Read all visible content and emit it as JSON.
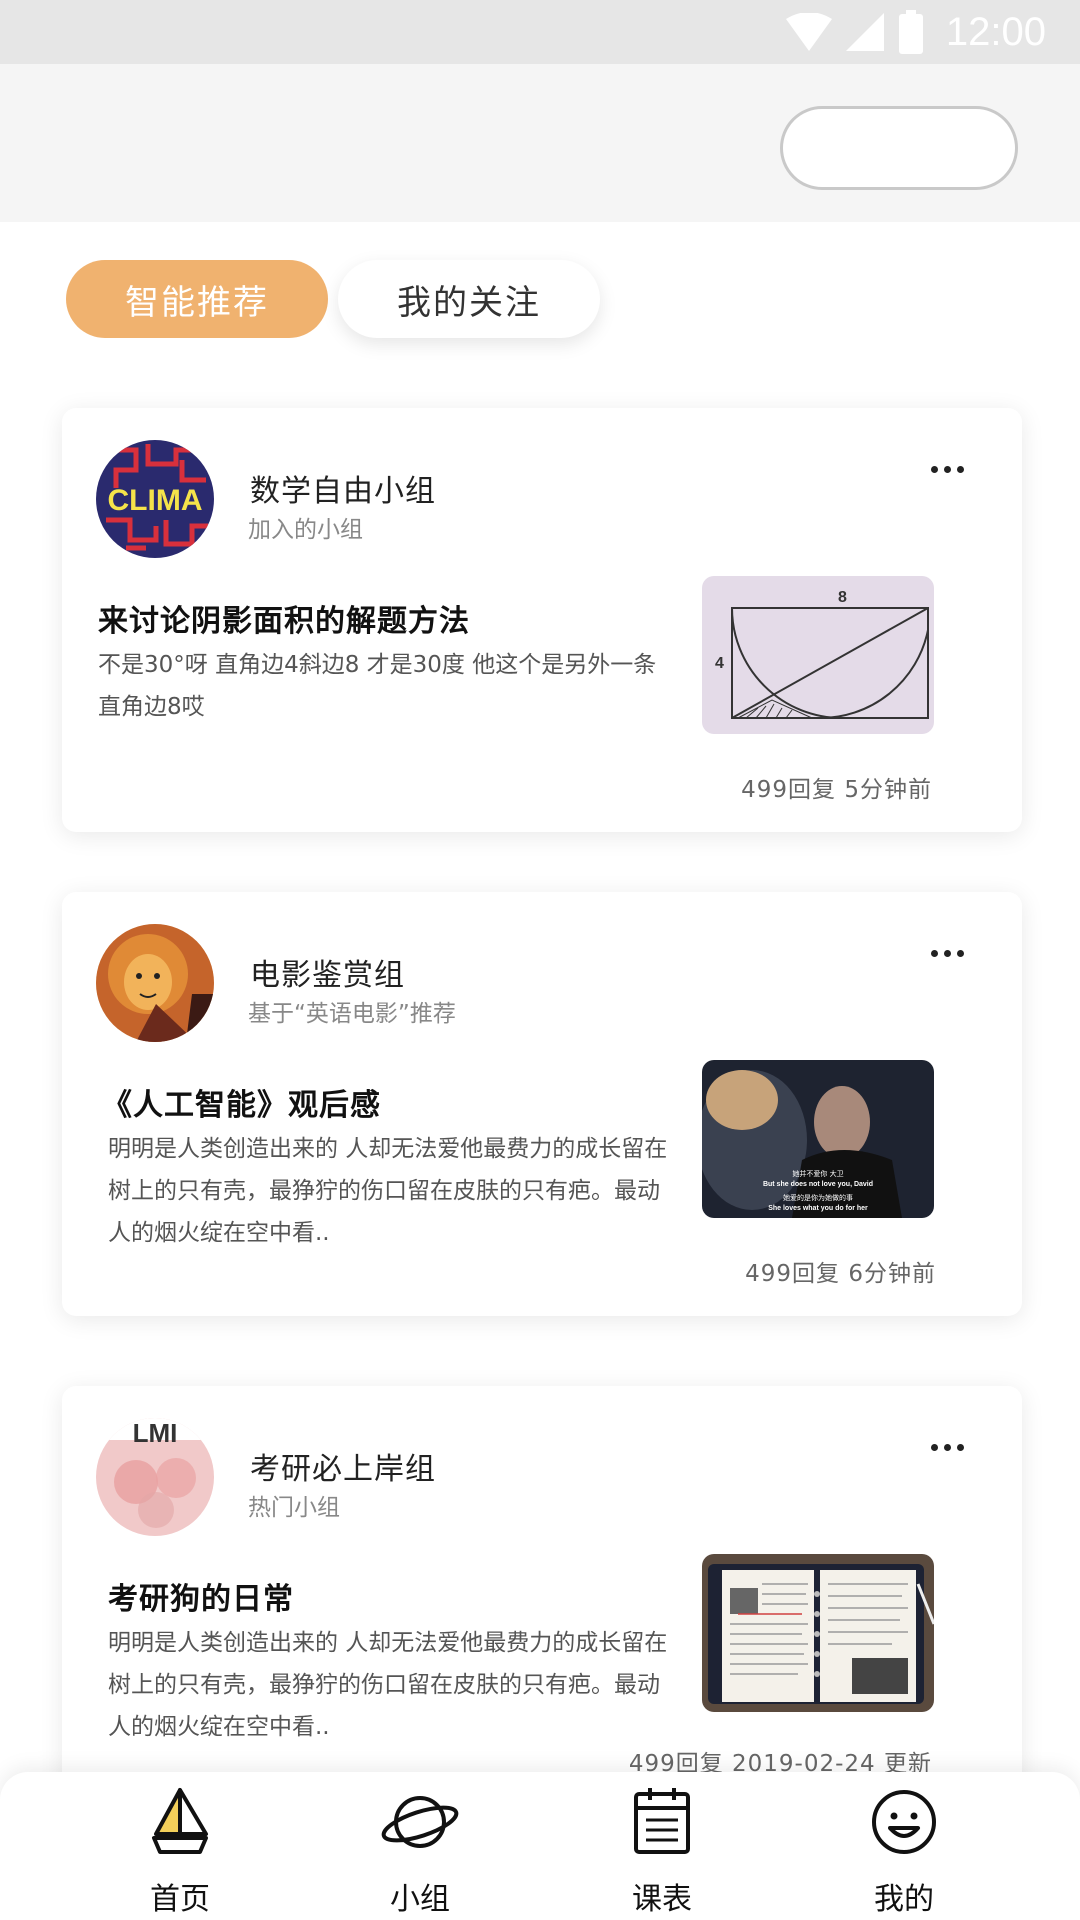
{
  "status_bar": {
    "time": "12:00"
  },
  "tabs": [
    {
      "label": "智能推荐",
      "active": true
    },
    {
      "label": "我的关注",
      "active": false
    }
  ],
  "cards": [
    {
      "group_name": "数学自由小组",
      "group_sub": "加入的小组",
      "post_title": "来讨论阴影面积的解题方法",
      "post_body": "不是30°呀 直角边4斜边8 才是30度 他这个是另外一条直角边8哎",
      "meta": "499回复 5分钟前",
      "avatar_text": "CLIMA",
      "thumb_labels": {
        "top": "8",
        "left": "4"
      }
    },
    {
      "group_name": "电影鉴赏组",
      "group_sub": "基于“英语电影”推荐",
      "post_title": "《人工智能》观后感",
      "post_body": "明明是人类创造出来的 人却无法爱他最费力的成长留在树上的只有壳，最狰狞的伤口留在皮肤的只有疤。最动人的烟火绽在空中看..",
      "meta": "499回复 6分钟前",
      "subtitles": [
        "她并不爱你 大卫",
        "But she does not love you, David",
        "她爱的是你为她做的事",
        "She loves what you do for her"
      ]
    },
    {
      "group_name": "考研必上岸组",
      "group_sub": "热门小组",
      "post_title": "考研狗的日常",
      "post_body": "明明是人类创造出来的 人却无法爱他最费力的成长留在树上的只有壳，最狰狞的伤口留在皮肤的只有疤。最动人的烟火绽在空中看..",
      "meta": "499回复 2019-02-24 更新",
      "avatar_text": "LMI"
    }
  ],
  "tabbar": [
    {
      "label": "首页",
      "icon": "sailboat-icon"
    },
    {
      "label": "小组",
      "icon": "planet-icon"
    },
    {
      "label": "课表",
      "icon": "calendar-icon"
    },
    {
      "label": "我的",
      "icon": "smiley-icon"
    }
  ],
  "colors": {
    "accent": "#f0b26f",
    "status_bar": "#e6e6e6",
    "header_bg": "#f5f5f5"
  }
}
